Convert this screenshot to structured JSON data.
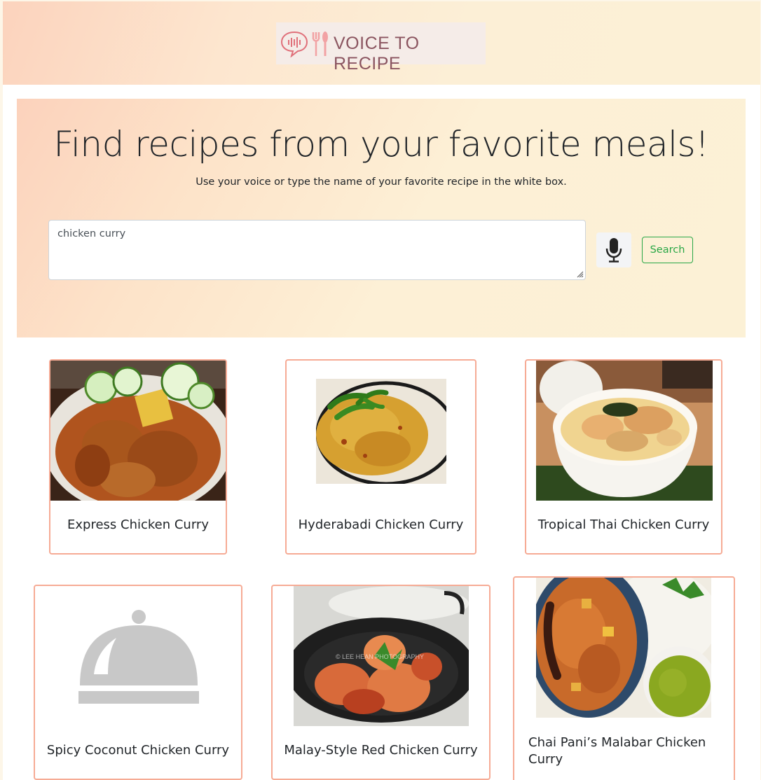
{
  "header": {
    "logo_text": "VOICE TO RECIPE"
  },
  "hero": {
    "title": "Find recipes from your favorite meals!",
    "subtitle": "Use your voice or type the name of your favorite recipe in the white box.",
    "search_value": "chicken curry",
    "mic_icon": "microphone-icon",
    "search_label": "Search"
  },
  "recipes": [
    {
      "title": "Express Chicken Curry",
      "image": "curry-bowl-with-cucumber"
    },
    {
      "title": "Hyderabadi Chicken Curry",
      "image": "curry-with-green-chilies"
    },
    {
      "title": "Tropical Thai Chicken Curry",
      "image": "thai-curry-bowl"
    },
    {
      "title": "Spicy Coconut Chicken Curry",
      "image": "placeholder-cloche-icon"
    },
    {
      "title": "Malay-Style Red Chicken Curry",
      "image": "red-curry-in-wok",
      "watermark": "© LEE HEAN PHOTOGRAPHY"
    },
    {
      "title": "Chai Pani’s Malabar Chicken Curry",
      "title_line1": "Chai Pani’s Malabar Chicken",
      "title_line2": "Curry",
      "image": "malabar-curry-with-chutney"
    }
  ],
  "colors": {
    "card_border": "#f6ab95",
    "search_button": "#28a745",
    "logo_text": "#8b5560"
  }
}
